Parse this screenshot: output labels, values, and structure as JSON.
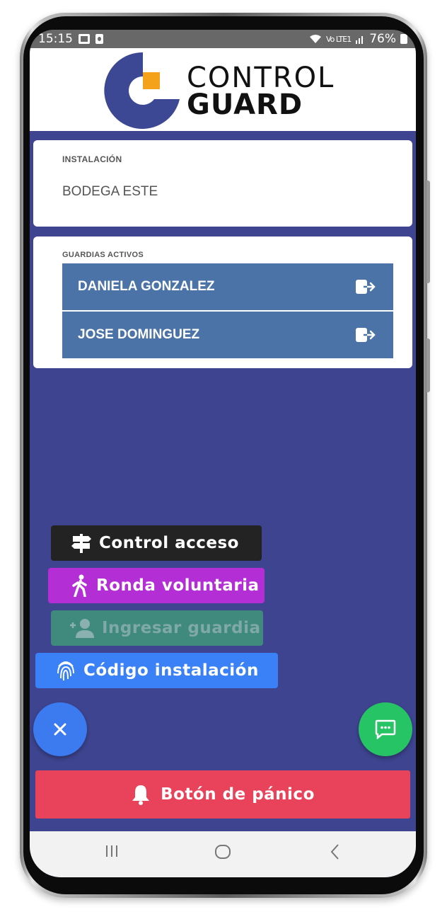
{
  "status_bar": {
    "time": "15:15",
    "battery": "76%",
    "signal_text": "Vo LTE1"
  },
  "header": {
    "logo_line1": "CONTROL",
    "logo_line2": "GUARD"
  },
  "installation": {
    "label": "INSTALACIÓN",
    "value": "BODEGA ESTE"
  },
  "guards": {
    "label": "GUARDIAS ACTIVOS",
    "items": [
      {
        "name": "DANIELA GONZALEZ"
      },
      {
        "name": "JOSE DOMINGUEZ"
      }
    ]
  },
  "actions": [
    {
      "label": "Control acceso",
      "icon": "signpost-icon",
      "color": "#232323"
    },
    {
      "label": "Ronda voluntaria",
      "icon": "walking-icon",
      "color": "#b42ed6"
    },
    {
      "label": "Ingresar guardia",
      "icon": "add-person-icon",
      "color": "#3f8a7d"
    },
    {
      "label": "Código instalación",
      "icon": "fingerprint-icon",
      "color": "#3a80f6"
    }
  ],
  "fab_close": {
    "icon": "close-icon",
    "color": "#3b7bef"
  },
  "fab_chat": {
    "icon": "chat-icon",
    "color": "#27c466"
  },
  "panic": {
    "label": "Botón de pánico",
    "icon": "bell-icon",
    "color": "#e8435a"
  },
  "colors": {
    "background": "#3e448f",
    "guard_row": "#4b73a7",
    "logo_blue": "#3d4895",
    "logo_orange": "#f5a21b"
  }
}
